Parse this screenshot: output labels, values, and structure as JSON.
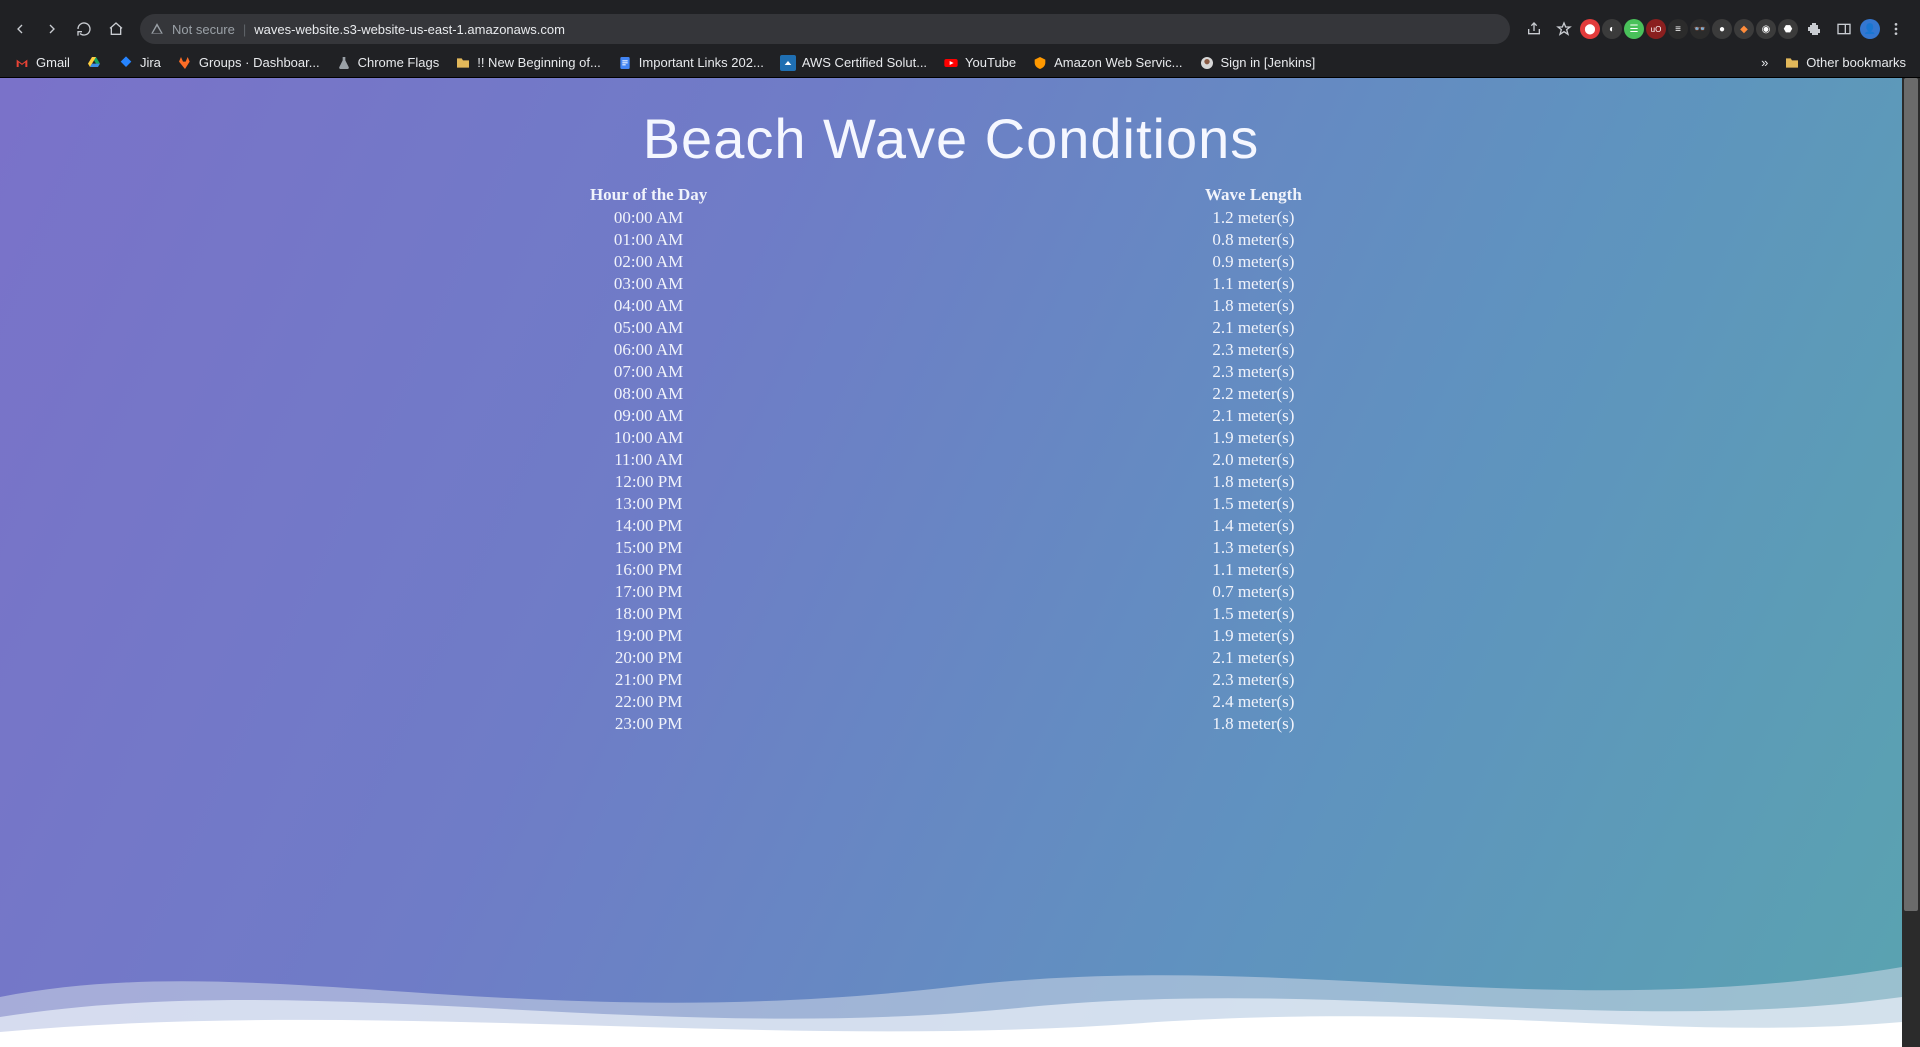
{
  "browser": {
    "security_label": "Not secure",
    "url": "waves-website.s3-website-us-east-1.amazonaws.com",
    "bookmarks": [
      {
        "icon": "gmail",
        "label": "Gmail"
      },
      {
        "icon": "drive",
        "label": ""
      },
      {
        "icon": "jira",
        "label": "Jira"
      },
      {
        "icon": "gitlab",
        "label": "Groups · Dashboar..."
      },
      {
        "icon": "flask",
        "label": "Chrome Flags"
      },
      {
        "icon": "folder",
        "label": "!! New Beginning of..."
      },
      {
        "icon": "gdoc",
        "label": "Important Links 202..."
      },
      {
        "icon": "aws",
        "label": "AWS Certified Solut..."
      },
      {
        "icon": "youtube",
        "label": "YouTube"
      },
      {
        "icon": "awscon",
        "label": "Amazon Web Servic..."
      },
      {
        "icon": "jenkins",
        "label": "Sign in [Jenkins]"
      }
    ],
    "overflow_label": "»",
    "other_bookmarks_label": "Other bookmarks"
  },
  "page": {
    "title": "Beach Wave Conditions",
    "col_hour": "Hour of the Day",
    "col_wave": "Wave Length",
    "rows": [
      {
        "hour": "00:00 AM",
        "wave": "1.2 meter(s)"
      },
      {
        "hour": "01:00 AM",
        "wave": "0.8 meter(s)"
      },
      {
        "hour": "02:00 AM",
        "wave": "0.9 meter(s)"
      },
      {
        "hour": "03:00 AM",
        "wave": "1.1 meter(s)"
      },
      {
        "hour": "04:00 AM",
        "wave": "1.8 meter(s)"
      },
      {
        "hour": "05:00 AM",
        "wave": "2.1 meter(s)"
      },
      {
        "hour": "06:00 AM",
        "wave": "2.3 meter(s)"
      },
      {
        "hour": "07:00 AM",
        "wave": "2.3 meter(s)"
      },
      {
        "hour": "08:00 AM",
        "wave": "2.2 meter(s)"
      },
      {
        "hour": "09:00 AM",
        "wave": "2.1 meter(s)"
      },
      {
        "hour": "10:00 AM",
        "wave": "1.9 meter(s)"
      },
      {
        "hour": "11:00 AM",
        "wave": "2.0 meter(s)"
      },
      {
        "hour": "12:00 PM",
        "wave": "1.8 meter(s)"
      },
      {
        "hour": "13:00 PM",
        "wave": "1.5 meter(s)"
      },
      {
        "hour": "14:00 PM",
        "wave": "1.4 meter(s)"
      },
      {
        "hour": "15:00 PM",
        "wave": "1.3 meter(s)"
      },
      {
        "hour": "16:00 PM",
        "wave": "1.1 meter(s)"
      },
      {
        "hour": "17:00 PM",
        "wave": "0.7 meter(s)"
      },
      {
        "hour": "18:00 PM",
        "wave": "1.5 meter(s)"
      },
      {
        "hour": "19:00 PM",
        "wave": "1.9 meter(s)"
      },
      {
        "hour": "20:00 PM",
        "wave": "2.1 meter(s)"
      },
      {
        "hour": "21:00 PM",
        "wave": "2.3 meter(s)"
      },
      {
        "hour": "22:00 PM",
        "wave": "2.4 meter(s)"
      },
      {
        "hour": "23:00 PM",
        "wave": "1.8 meter(s)"
      }
    ]
  },
  "chart_data": {
    "type": "table",
    "title": "Beach Wave Conditions",
    "columns": [
      "Hour of the Day",
      "Wave Length (meters)"
    ],
    "categories": [
      "00:00",
      "01:00",
      "02:00",
      "03:00",
      "04:00",
      "05:00",
      "06:00",
      "07:00",
      "08:00",
      "09:00",
      "10:00",
      "11:00",
      "12:00",
      "13:00",
      "14:00",
      "15:00",
      "16:00",
      "17:00",
      "18:00",
      "19:00",
      "20:00",
      "21:00",
      "22:00",
      "23:00"
    ],
    "values": [
      1.2,
      0.8,
      0.9,
      1.1,
      1.8,
      2.1,
      2.3,
      2.3,
      2.2,
      2.1,
      1.9,
      2.0,
      1.8,
      1.5,
      1.4,
      1.3,
      1.1,
      0.7,
      1.5,
      1.9,
      2.1,
      2.3,
      2.4,
      1.8
    ],
    "xlabel": "Hour of the Day",
    "ylabel": "Wave Length (meters)",
    "ylim": [
      0,
      3
    ]
  }
}
